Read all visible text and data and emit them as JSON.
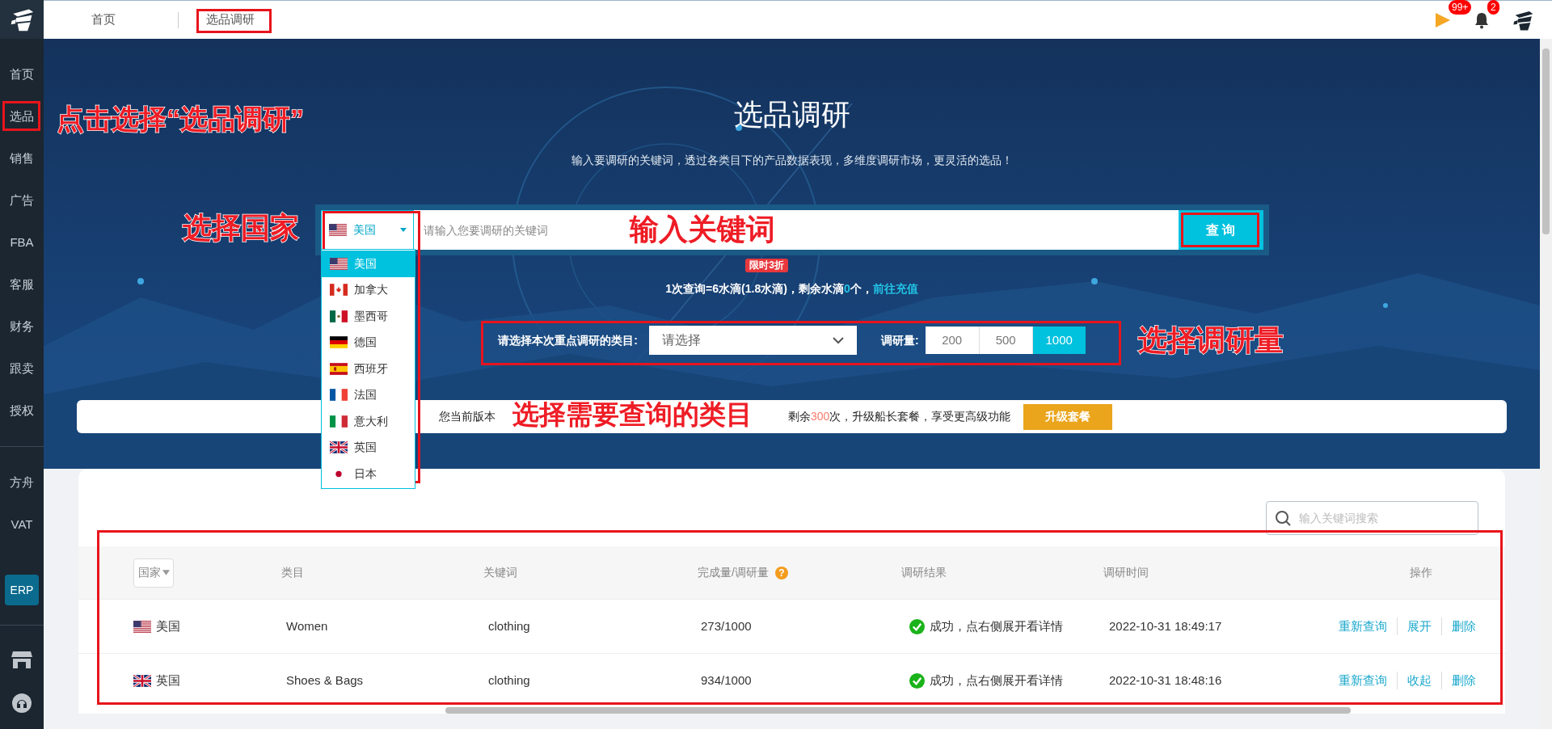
{
  "sidebar": {
    "main_items": [
      "首页",
      "选品",
      "销售",
      "广告",
      "FBA",
      "客服",
      "财务",
      "跟卖",
      "授权"
    ],
    "extra_items": [
      "方舟",
      "VAT"
    ],
    "erp_button": "ERP"
  },
  "top_nav": {
    "breadcrumbs": [
      "首页",
      "选品调研"
    ],
    "flag_badge": "99+",
    "bell_badge": "2"
  },
  "hero": {
    "title": "选品调研",
    "subtitle": "输入要调研的关键词，透过各类目下的产品数据表现，多维度调研市场，更灵活的选品！",
    "search": {
      "country": "美国",
      "kind": "us",
      "placeholder": "请输入您要调研的关键词",
      "button": "查 询"
    },
    "country_options": [
      {
        "label": "美国",
        "kind": "us",
        "selected": true
      },
      {
        "label": "加拿大",
        "kind": "ca",
        "selected": false
      },
      {
        "label": "墨西哥",
        "kind": "mx",
        "selected": false
      },
      {
        "label": "德国",
        "kind": "de",
        "selected": false
      },
      {
        "label": "西班牙",
        "kind": "es",
        "selected": false
      },
      {
        "label": "法国",
        "kind": "fr",
        "selected": false
      },
      {
        "label": "意大利",
        "kind": "it",
        "selected": false
      },
      {
        "label": "英国",
        "kind": "gb",
        "selected": false
      },
      {
        "label": "日本",
        "kind": "jp",
        "selected": false
      }
    ],
    "promo_badge": "限时3折",
    "cost_before": "1次查询=6水滴(1.8水滴)，剩余水滴",
    "cost_count": "0",
    "cost_after": "个，",
    "recharge_link": "前往充值",
    "category_label": "请选择本次重点调研的类目:",
    "category_placeholder": "请选择",
    "amount_label": "调研量:",
    "amounts": [
      {
        "label": "200",
        "selected": false
      },
      {
        "label": "500",
        "selected": false
      },
      {
        "label": "1000",
        "selected": true
      }
    ]
  },
  "banner": {
    "text_start": "您当前版本",
    "text_before": "剩余",
    "count": "300",
    "text_after": "次，升级船长套餐，享受更高级功能",
    "button": "升级套餐"
  },
  "table": {
    "search_placeholder": "输入关键词搜索",
    "columns": [
      {
        "label": "国家",
        "kind": "filter"
      },
      {
        "label": "类目",
        "kind": "plain"
      },
      {
        "label": "关键词",
        "kind": "plain"
      },
      {
        "label": "完成量/调研量",
        "kind": "help",
        "help": "?"
      },
      {
        "label": "调研结果",
        "kind": "plain"
      },
      {
        "label": "调研时间",
        "kind": "plain"
      },
      {
        "label": "操作",
        "kind": "actions"
      }
    ],
    "rows": [
      {
        "country": "美国",
        "kind": "us",
        "category": "Women",
        "keyword": "clothing",
        "progress": "273/1000",
        "result": {
          "kind": "success",
          "text": "成功，点右侧展开看详情"
        },
        "time": "2022-10-31 18:49:17",
        "actions": [
          "重新查询",
          "展开",
          "删除"
        ]
      },
      {
        "country": "英国",
        "kind": "gb",
        "category": "Shoes & Bags",
        "keyword": "clothing",
        "progress": "934/1000",
        "result": {
          "kind": "success",
          "text": "成功，点右侧展开看详情"
        },
        "time": "2022-10-31 18:48:16",
        "actions": [
          "重新查询",
          "收起",
          "删除"
        ]
      }
    ]
  },
  "annotations": [
    "点击选择“选品调研”",
    "选择国家",
    "输入关键词",
    "选择调研量",
    "选择需要查询的类目"
  ]
}
